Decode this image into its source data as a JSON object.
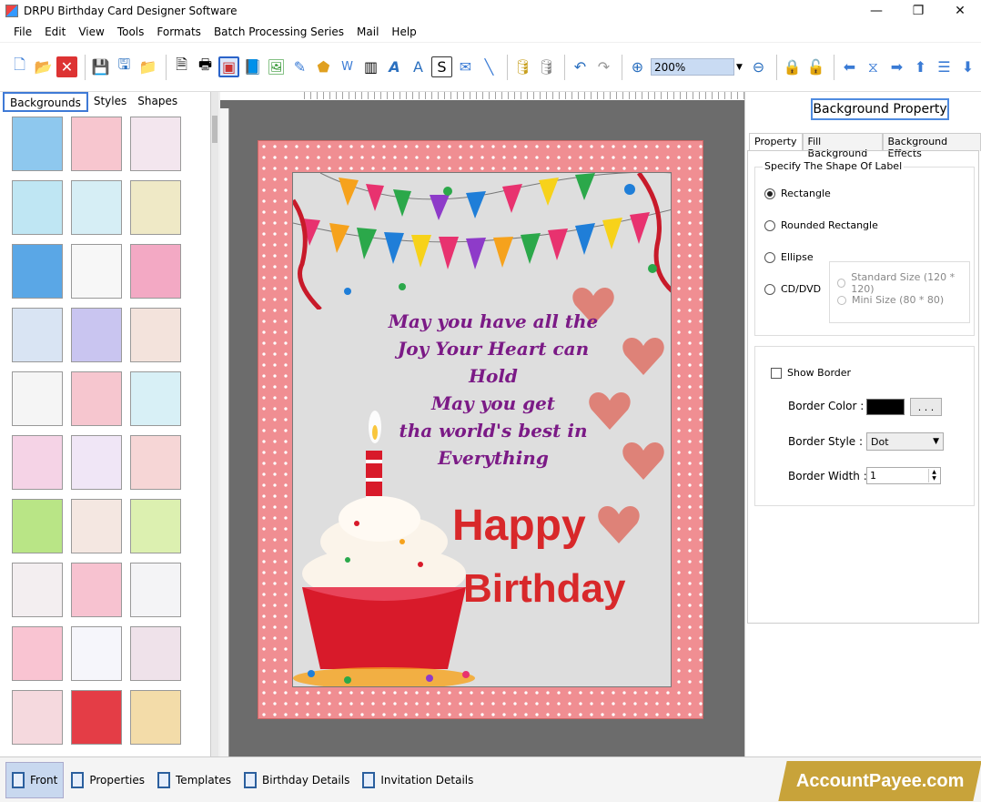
{
  "window": {
    "title": "DRPU Birthday Card Designer Software",
    "controls": [
      "—",
      "❐",
      "✕"
    ]
  },
  "menu": [
    "File",
    "Edit",
    "View",
    "Tools",
    "Formats",
    "Batch Processing Series",
    "Mail",
    "Help"
  ],
  "toolbar": {
    "zoom_value": "200%"
  },
  "left_panel": {
    "tabs": [
      "Backgrounds",
      "Styles",
      "Shapes"
    ],
    "thumbnails": [
      {
        "color": "#8ec8ee"
      },
      {
        "color": "#f7c6cf"
      },
      {
        "color": "#f3e6ee"
      },
      {
        "color": "#bfe6f3"
      },
      {
        "color": "#d6eef5"
      },
      {
        "color": "#efe9c6"
      },
      {
        "color": "#5aa7e6"
      },
      {
        "color": "#f7f7f7"
      },
      {
        "color": "#f3a9c4"
      },
      {
        "color": "#d9e4f3"
      },
      {
        "color": "#c9c5f0"
      },
      {
        "color": "#f3e3dc"
      },
      {
        "color": "#f5f5f5"
      },
      {
        "color": "#f6c6cf"
      },
      {
        "color": "#d8f0f6"
      },
      {
        "color": "#f5d3e6"
      },
      {
        "color": "#f0e6f6"
      },
      {
        "color": "#f6d6d6"
      },
      {
        "color": "#b9e586"
      },
      {
        "color": "#f4e7e1"
      },
      {
        "color": "#dcf0b0"
      },
      {
        "color": "#f3eef0"
      },
      {
        "color": "#f7c2d0"
      },
      {
        "color": "#f4f4f6"
      },
      {
        "color": "#f9c4d2"
      },
      {
        "color": "#f6f6fb"
      },
      {
        "color": "#efe2ea"
      },
      {
        "color": "#f5d9de"
      },
      {
        "color": "#e43d46"
      },
      {
        "color": "#f3dca9"
      }
    ]
  },
  "card": {
    "message": [
      "May you have all the",
      "Joy Your Heart can",
      "Hold",
      "May you get",
      "tha world's best in",
      "Everything"
    ],
    "happy": "Happy",
    "birthday": "Birthday"
  },
  "right_panel": {
    "header": "Background Property",
    "tabs": [
      "Property",
      "Fill Background",
      "Background Effects"
    ],
    "shape_group_label": "Specify The Shape Of Label",
    "shapes": [
      "Rectangle",
      "Rounded Rectangle",
      "Ellipse",
      "CD/DVD"
    ],
    "selected_shape": "Rectangle",
    "cd_options": [
      "Standard Size (120 * 120)",
      "Mini Size (80 * 80)"
    ],
    "show_border_label": "Show Border",
    "show_border_checked": false,
    "border_color_label": "Border Color :",
    "border_color_value": "#000000",
    "dots_button": ". . .",
    "border_style_label": "Border Style :",
    "border_style_value": "Dot",
    "border_width_label": "Border Width :",
    "border_width_value": "1"
  },
  "bottom_tabs": [
    "Front",
    "Properties",
    "Templates",
    "Birthday Details",
    "Invitation Details"
  ],
  "watermark": "AccountPayee.com"
}
